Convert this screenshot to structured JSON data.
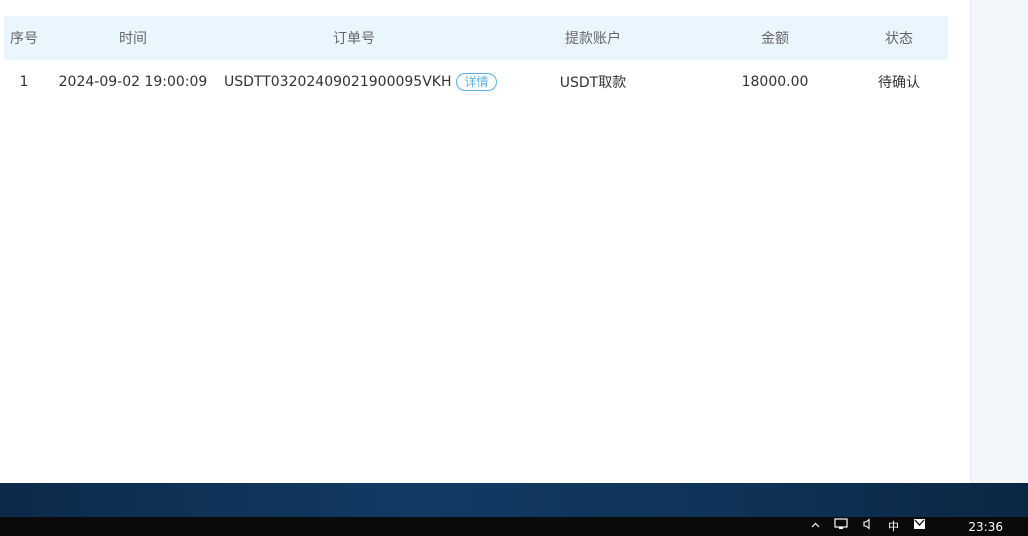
{
  "table": {
    "headers": {
      "index": "序号",
      "time": "时间",
      "order_no": "订单号",
      "account": "提款账户",
      "amount": "金额",
      "status": "状态"
    },
    "rows": [
      {
        "index": "1",
        "time": "2024-09-02 19:00:09",
        "order_no": "USDTT03202409021900095VKH",
        "detail_label": "详情",
        "account": "USDT取款",
        "amount": "18000.00",
        "status": "待确认"
      }
    ]
  },
  "colors": {
    "header_bg": "#eaf6fd",
    "status_pending": "#e23a3a",
    "detail_accent": "#5bb0e8"
  },
  "taskbar": {
    "clock": "23:36",
    "tray_icons": [
      "chevron-up-icon",
      "network-icon",
      "volume-icon",
      "ime-zh-icon",
      "mail-icon"
    ],
    "ime_label": "中"
  }
}
